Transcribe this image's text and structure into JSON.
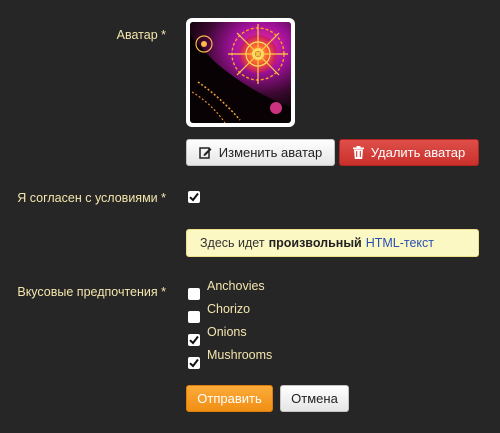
{
  "avatar": {
    "label": "Аватар *",
    "change_button": "Изменить аватар",
    "delete_button": "Удалить аватар"
  },
  "terms": {
    "label": "Я согласен с условиями *",
    "checked": true
  },
  "info": {
    "prefix": "Здесь идет",
    "bold": "произвольный",
    "suffix": "HTML-текст"
  },
  "preferences": {
    "label": "Вкусовые предпочтения *",
    "options": [
      {
        "label": "Anchovies",
        "checked": false
      },
      {
        "label": "Chorizo",
        "checked": false
      },
      {
        "label": "Onions",
        "checked": true
      },
      {
        "label": "Mushrooms",
        "checked": true
      }
    ]
  },
  "actions": {
    "submit": "Отправить",
    "cancel": "Отмена"
  },
  "colors": {
    "background": "#262626",
    "label": "#f4e6ad",
    "danger": "#d9534f",
    "warning": "#f89c20",
    "info_bg": "#fcf8c4"
  },
  "icons": {
    "edit": "edit-icon",
    "delete": "trash-icon",
    "check": "checkmark-icon"
  }
}
